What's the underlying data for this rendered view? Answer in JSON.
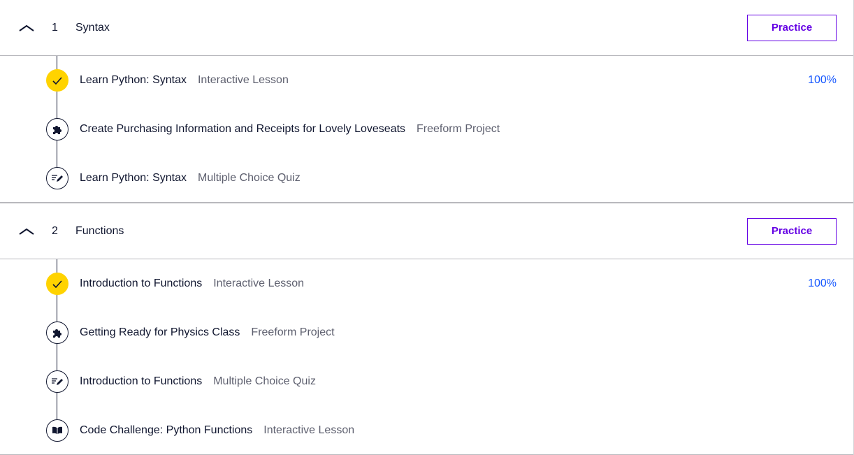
{
  "sections": [
    {
      "number": "1",
      "title": "Syntax",
      "practice_label": "Practice",
      "items": [
        {
          "title": "Learn Python: Syntax",
          "type": "Interactive Lesson",
          "progress": "100%",
          "status": "done",
          "icon": "check-icon"
        },
        {
          "title": "Create Purchasing Information and Receipts for Lovely Loveseats",
          "type": "Freeform Project",
          "progress": "",
          "status": "todo",
          "icon": "puzzle-icon"
        },
        {
          "title": "Learn Python: Syntax",
          "type": "Multiple Choice Quiz",
          "progress": "",
          "status": "todo",
          "icon": "quiz-pencil-icon"
        }
      ]
    },
    {
      "number": "2",
      "title": "Functions",
      "practice_label": "Practice",
      "items": [
        {
          "title": "Introduction to Functions",
          "type": "Interactive Lesson",
          "progress": "100%",
          "status": "done",
          "icon": "check-icon"
        },
        {
          "title": "Getting Ready for Physics Class",
          "type": "Freeform Project",
          "progress": "",
          "status": "todo",
          "icon": "puzzle-icon"
        },
        {
          "title": "Introduction to Functions",
          "type": "Multiple Choice Quiz",
          "progress": "",
          "status": "todo",
          "icon": "quiz-pencil-icon"
        },
        {
          "title": "Code Challenge: Python Functions",
          "type": "Interactive Lesson",
          "progress": "",
          "status": "todo",
          "icon": "book-icon"
        }
      ]
    }
  ],
  "colors": {
    "accent": "#6400e4",
    "progress": "#1557ff",
    "done": "#ffd300",
    "text": "#10162f",
    "muted": "#5d5f6e"
  }
}
